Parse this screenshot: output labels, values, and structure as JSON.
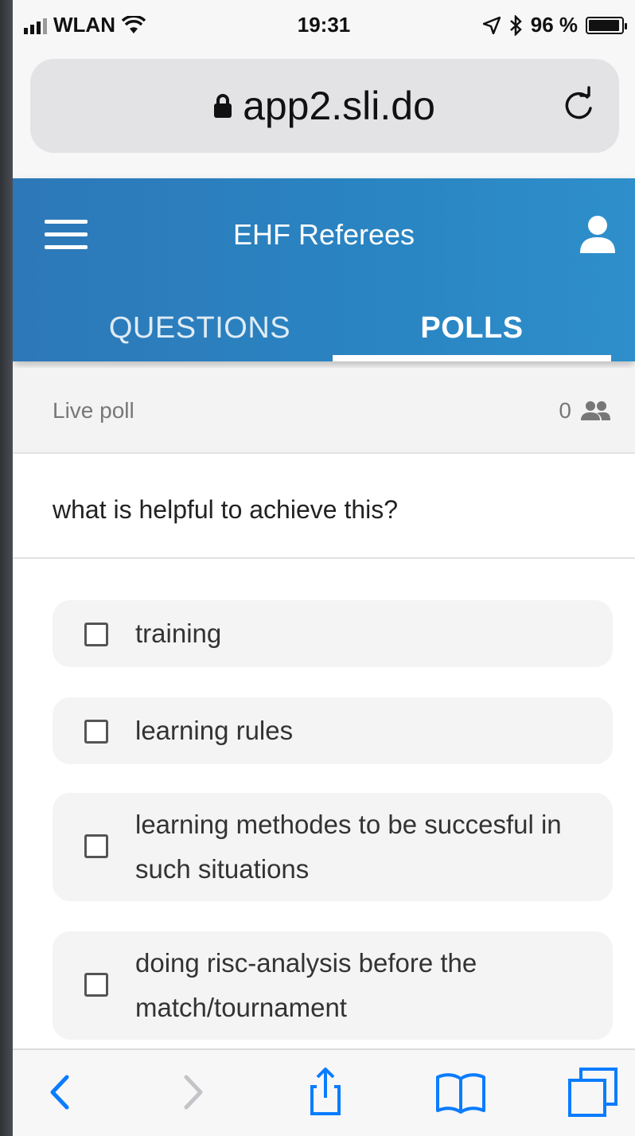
{
  "status_bar": {
    "carrier": "WLAN",
    "time": "19:31",
    "battery": "96 %",
    "battery_level_percent": 96,
    "icons": [
      "signal-icon",
      "wifi-icon",
      "location-arrow-icon",
      "bluetooth-icon",
      "battery-icon"
    ]
  },
  "browser": {
    "url": "app2.sli.do",
    "icons": [
      "lock-icon",
      "reload-icon"
    ]
  },
  "header": {
    "title": "EHF Referees",
    "icons": [
      "menu-icon",
      "user-icon"
    ]
  },
  "tabs": [
    {
      "label": "QUESTIONS",
      "active": false
    },
    {
      "label": "POLLS",
      "active": true
    }
  ],
  "poll": {
    "status_label": "Live poll",
    "participants": "0",
    "question": "what is helpful to achieve this?",
    "options": [
      {
        "label": "training",
        "checked": false
      },
      {
        "label": "learning rules",
        "checked": false
      },
      {
        "label": "learning methodes to be succesful in such situations",
        "checked": false
      },
      {
        "label": "doing risc-analysis before the match/tournament",
        "checked": false
      }
    ]
  },
  "toolbar": {
    "icons": [
      "back-icon",
      "forward-icon",
      "share-icon",
      "bookmarks-icon",
      "tabs-icon"
    ]
  },
  "colors": {
    "header_blue": "#2a85c2",
    "ios_blue": "#0a7cff",
    "background_gray": "#f3f3f3"
  }
}
